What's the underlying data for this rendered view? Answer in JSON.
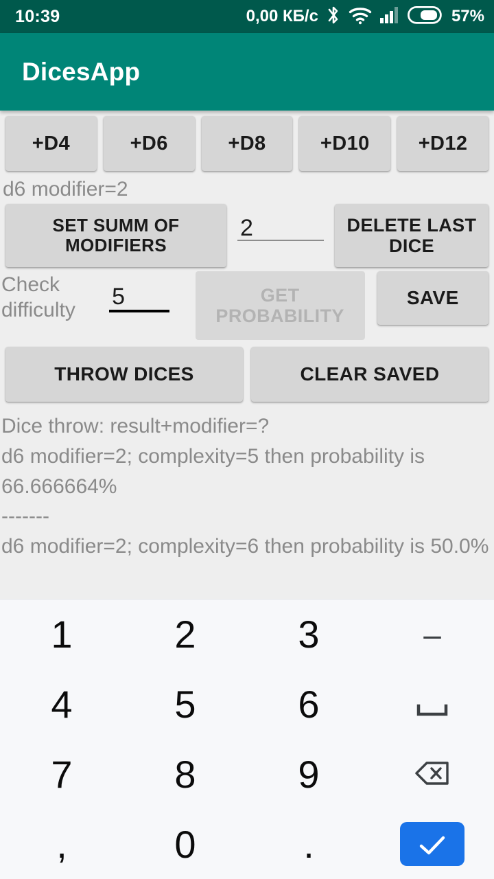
{
  "statusbar": {
    "time": "10:39",
    "data_rate": "0,00 КБ/с",
    "battery_percent": "57%",
    "icons": [
      "bluetooth-icon",
      "wifi-icon",
      "signal-icon",
      "battery-icon"
    ],
    "background_color": "#00594c",
    "text_color": "#ffffff"
  },
  "appbar": {
    "title": "DicesApp",
    "background_color": "#008577",
    "text_color": "#ffffff"
  },
  "dice_buttons": [
    {
      "label": "+D4"
    },
    {
      "label": "+D6"
    },
    {
      "label": "+D8"
    },
    {
      "label": "+D10"
    },
    {
      "label": "+D12"
    }
  ],
  "dice_status": "d6 modifier=2",
  "modifier_row": {
    "set_summ_label": "SET SUMM OF MODIFIERS",
    "modifier_value": "2",
    "delete_label": "DELETE LAST DICE"
  },
  "difficulty_row": {
    "check_label": "Check difficulty",
    "difficulty_value": "5",
    "get_probability_label": "GET PROBABILITY",
    "get_probability_disabled": true,
    "save_label": "SAVE"
  },
  "action_row": {
    "throw_label": "THROW DICES",
    "clear_label": "CLEAR SAVED"
  },
  "results": [
    "Dice throw: result+modifier=?",
    "d6 modifier=2; complexity=5 then probability is 66.666664%",
    "-------",
    "d6 modifier=2; complexity=6 then probability is 50.0%"
  ],
  "keyboard": {
    "accent_color": "#1a73e8",
    "background_color": "#f7f8fa",
    "rows": [
      [
        {
          "label": "1",
          "name": "key-1",
          "type": "num"
        },
        {
          "label": "2",
          "name": "key-2",
          "type": "num"
        },
        {
          "label": "3",
          "name": "key-3",
          "type": "num"
        },
        {
          "label": "–",
          "name": "key-minus",
          "type": "minus"
        }
      ],
      [
        {
          "label": "4",
          "name": "key-4",
          "type": "num"
        },
        {
          "label": "5",
          "name": "key-5",
          "type": "num"
        },
        {
          "label": "6",
          "name": "key-6",
          "type": "num"
        },
        {
          "label": "",
          "name": "key-space",
          "type": "space"
        }
      ],
      [
        {
          "label": "7",
          "name": "key-7",
          "type": "num"
        },
        {
          "label": "8",
          "name": "key-8",
          "type": "num"
        },
        {
          "label": "9",
          "name": "key-9",
          "type": "num"
        },
        {
          "label": "",
          "name": "key-backspace",
          "type": "backspace"
        }
      ],
      [
        {
          "label": ",",
          "name": "key-comma",
          "type": "comma"
        },
        {
          "label": "0",
          "name": "key-0",
          "type": "num"
        },
        {
          "label": ".",
          "name": "key-dot",
          "type": "dot"
        },
        {
          "label": "",
          "name": "key-enter",
          "type": "enter"
        }
      ]
    ]
  }
}
